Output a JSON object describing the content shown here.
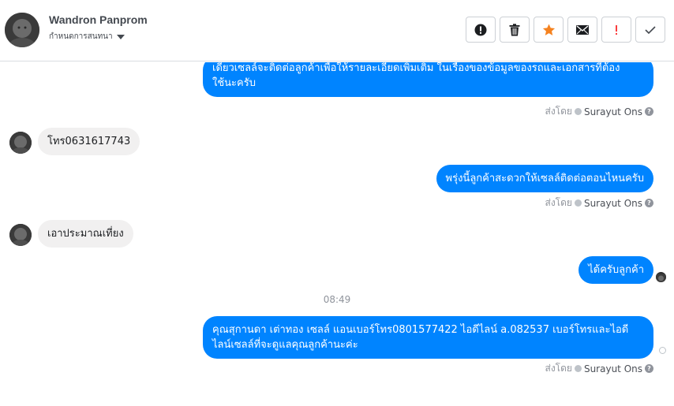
{
  "header": {
    "contact_name": "Wandron Panprom",
    "conversation_settings": "กำหนดการสนทนา"
  },
  "toolbar": {
    "buttons": [
      {
        "name": "mark-spam-button",
        "icon": "alert-circle-icon"
      },
      {
        "name": "delete-button",
        "icon": "trash-icon"
      },
      {
        "name": "star-button",
        "icon": "star-icon",
        "color": "#f5821f"
      },
      {
        "name": "mark-unread-button",
        "icon": "envelope-icon"
      },
      {
        "name": "follow-up-button",
        "icon": "exclamation-icon",
        "color": "#fa3e3e"
      },
      {
        "name": "mark-done-button",
        "icon": "check-icon"
      }
    ]
  },
  "colors": {
    "outgoing_bubble": "#0084ff",
    "incoming_bubble": "#f1f0f0"
  },
  "thread": {
    "msg1": {
      "line1": "เดี๋ยวเซลล์จะติดต่อลูกค้าเพื่อให้รายละเอียดเพิ่มเติม ในเรื่องของข้อมูลของรถและเอกสารที่ต้อง",
      "line2": "ใช้นะครับ"
    },
    "msg1_sent_by": {
      "label": "ส่งโดย",
      "agent": "Surayut Ons"
    },
    "msg2": "โทร0631617743",
    "msg3": "พรุ่งนี้ลูกค้าสะดวกให้เซลล์ติดต่อตอนไหนครับ",
    "msg3_sent_by": {
      "label": "ส่งโดย",
      "agent": "Surayut Ons"
    },
    "msg4": "เอาประมาณเที่ยง",
    "msg5": "ได้ครับลูกค้า",
    "time_divider": "08:49",
    "msg6": {
      "line1": "คุณสุกานดา เต่าทอง  เซลล์ แอนเบอร์โทร0801577422 ไอดีไลน์ a.082537  เบอร์โทรและไอดี",
      "line2": "ไลน์เซลล์ที่จะดูแลคุณลูกค้านะค่ะ"
    },
    "msg6_sent_by": {
      "label": "ส่งโดย",
      "agent": "Surayut Ons"
    }
  }
}
